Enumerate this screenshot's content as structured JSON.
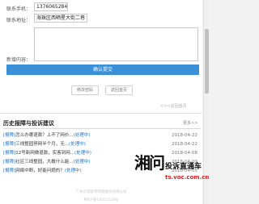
{
  "form": {
    "phone_label": "联系手机：",
    "phone_value": "13760652847",
    "address_label": "联系地址：",
    "address_value": "海珠区西晒星大街二巷",
    "content_label": "新增内容：",
    "submit_label": "确认提交",
    "edit_password_label": "修改密码",
    "back_home_label": "返回首页",
    "back_link_label": "<<<返回首页"
  },
  "history": {
    "title": "历史报障与投诉建议",
    "more_label": "更多>>",
    "items": [
      {
        "tag": "[报障]",
        "title": "怎么办哪退款？上不了网价...",
        "status": "(处理中)",
        "date": "2018-04-22"
      },
      {
        "tag": "[报障]",
        "title": "三线整园停网半个月，无...",
        "status": "(处理中)",
        "date": "2018-04-22"
      },
      {
        "tag": "[报障]",
        "title": "12号新网做退款，实客到网...",
        "status": "(处理中)",
        "date": "2018-04-08"
      },
      {
        "tag": "[报障]",
        "title": "社区三线整园，大概什么能...",
        "status": "(处理中)",
        "date": "2018-04-09"
      },
      {
        "tag": "[报障]",
        "title": "网络中断，好能问题的？",
        "status": "(处理中)",
        "date": "2018-04-05"
      }
    ]
  },
  "footer": {
    "line1": "广州云城宽带网络股份有限公司",
    "line2": "粤ICP备14022326号"
  },
  "watermark": {
    "logo_text": "湘问",
    "slogan": "投诉直通车",
    "domain": "ts.voc.com.cn"
  }
}
